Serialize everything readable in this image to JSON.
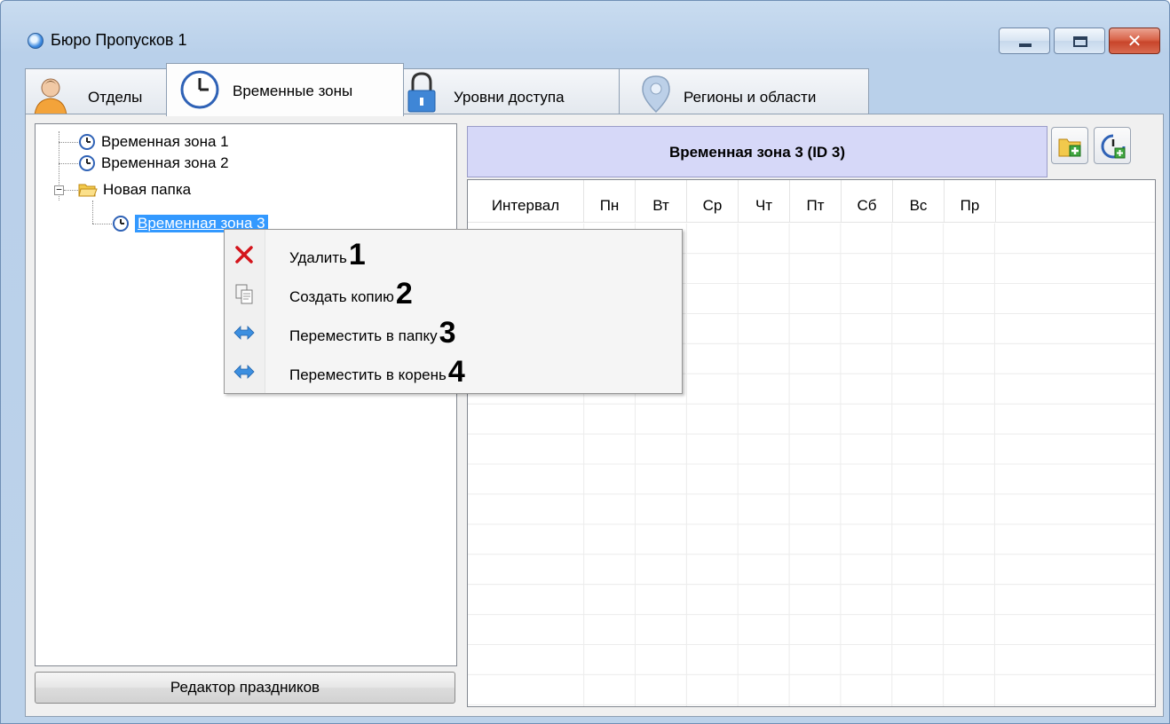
{
  "window": {
    "title": "Бюро Пропусков 1",
    "close_glyph": "✕"
  },
  "tabs": [
    {
      "label": "Отделы",
      "icon": "person-icon"
    },
    {
      "label": "Временные зоны",
      "icon": "clock-icon",
      "active": true
    },
    {
      "label": "Уровни доступа",
      "icon": "padlock-icon"
    },
    {
      "label": "Регионы и области",
      "icon": "map-pin-icon"
    }
  ],
  "tree": {
    "items": [
      {
        "label": "Временная зона 1"
      },
      {
        "label": "Временная зона 2"
      },
      {
        "label": "Новая папка"
      },
      {
        "label": "Временная зона 3",
        "selected": true
      }
    ],
    "expander_glyph": "−"
  },
  "holidays_button": "Редактор праздников",
  "zone_header": "Временная зона 3 (ID 3)",
  "grid": {
    "columns": [
      "Интервал",
      "Пн",
      "Вт",
      "Ср",
      "Чт",
      "Пт",
      "Сб",
      "Вс",
      "Пр"
    ]
  },
  "context_menu": [
    {
      "label": "Удалить",
      "number": "1",
      "icon": "delete-x-icon"
    },
    {
      "label": "Создать копию",
      "number": "2",
      "icon": "copy-icon"
    },
    {
      "label": "Переместить в папку",
      "number": "3",
      "icon": "move-arrow-icon"
    },
    {
      "label": "Переместить в корень",
      "number": "4",
      "icon": "move-arrow-icon"
    }
  ],
  "colors": {
    "selection": "#3399ff",
    "header_bg": "#d6d8f8",
    "delete_icon": "#d4141b",
    "move_icon": "#3c8fe0"
  }
}
